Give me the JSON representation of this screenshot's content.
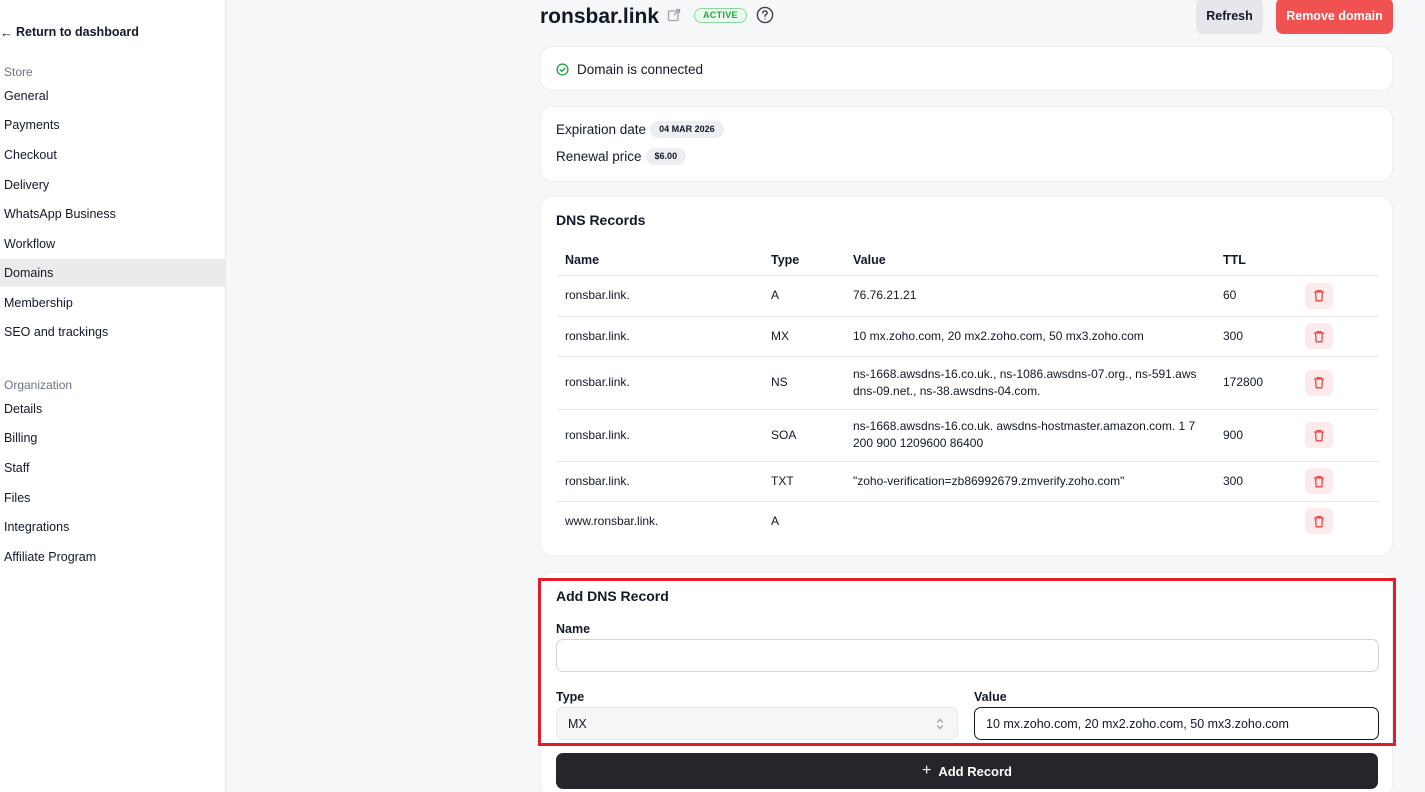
{
  "sidebar": {
    "back_label": "Return to dashboard",
    "store_label": "Store",
    "store_items": [
      "General",
      "Payments",
      "Checkout",
      "Delivery",
      "WhatsApp Business",
      "Workflow",
      "Domains",
      "Membership",
      "SEO and trackings"
    ],
    "active_item": "Domains",
    "org_label": "Organization",
    "org_items": [
      "Details",
      "Billing",
      "Staff",
      "Files",
      "Integrations",
      "Affiliate Program"
    ]
  },
  "header": {
    "domain": "ronsbar.link",
    "status": "ACTIVE",
    "refresh_label": "Refresh",
    "remove_label": "Remove domain"
  },
  "connection": {
    "status_text": "Domain is connected"
  },
  "details": {
    "expiration_label": "Expiration date",
    "expiration_value": "04 MAR 2026",
    "renewal_label": "Renewal price",
    "renewal_value": "$6.00"
  },
  "dns": {
    "title": "DNS Records",
    "columns": [
      "Name",
      "Type",
      "Value",
      "TTL"
    ],
    "records": [
      {
        "name": "ronsbar.link.",
        "type": "A",
        "value": "76.76.21.21",
        "ttl": "60"
      },
      {
        "name": "ronsbar.link.",
        "type": "MX",
        "value": "10 mx.zoho.com, 20 mx2.zoho.com, 50 mx3.zoho.com",
        "ttl": "300"
      },
      {
        "name": "ronsbar.link.",
        "type": "NS",
        "value": "ns-1668.awsdns-16.co.uk., ns-1086.awsdns-07.org., ns-591.awsdns-09.net., ns-38.awsdns-04.com.",
        "ttl": "172800"
      },
      {
        "name": "ronsbar.link.",
        "type": "SOA",
        "value": "ns-1668.awsdns-16.co.uk. awsdns-hostmaster.amazon.com. 1 7200 900 1209600 86400",
        "ttl": "900"
      },
      {
        "name": "ronsbar.link.",
        "type": "TXT",
        "value": "\"zoho-verification=zb86992679.zmverify.zoho.com\"",
        "ttl": "300"
      },
      {
        "name": "www.ronsbar.link.",
        "type": "A",
        "value": "",
        "ttl": ""
      }
    ]
  },
  "add_record": {
    "title": "Add DNS Record",
    "name_label": "Name",
    "name_value": "",
    "type_label": "Type",
    "type_value": "MX",
    "value_label": "Value",
    "value_value": "10 mx.zoho.com, 20 mx2.zoho.com, 50 mx3.zoho.com",
    "submit_label": "Add Record"
  },
  "colors": {
    "accent_danger": "#f05252",
    "success": "#22a447",
    "highlight": "#e11d2a",
    "primary_button": "#24262b"
  }
}
